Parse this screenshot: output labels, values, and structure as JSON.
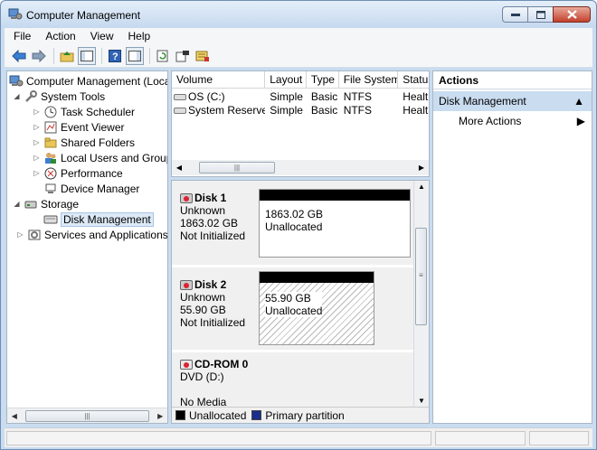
{
  "window": {
    "title": "Computer Management"
  },
  "menu": [
    "File",
    "Action",
    "View",
    "Help"
  ],
  "toolbar_icons": [
    "back-icon",
    "forward-icon",
    "up-folder-icon",
    "show-tree-icon",
    "help-icon",
    "show-action-pane-icon",
    "refresh-icon",
    "properties-icon",
    "disk-settings-icon"
  ],
  "tree": {
    "root": "Computer Management (Local",
    "system_tools": "System Tools",
    "task_scheduler": "Task Scheduler",
    "event_viewer": "Event Viewer",
    "shared_folders": "Shared Folders",
    "local_users": "Local Users and Groups",
    "performance": "Performance",
    "device_manager": "Device Manager",
    "storage": "Storage",
    "disk_management": "Disk Management",
    "services": "Services and Applications"
  },
  "volume_list": {
    "columns": [
      "Volume",
      "Layout",
      "Type",
      "File System",
      "Status"
    ],
    "column_headers_visible": [
      "Volume",
      "Layout",
      "Type",
      "File System",
      "Statu"
    ],
    "rows": [
      [
        "OS (C:)",
        "Simple",
        "Basic",
        "NTFS",
        "Healt"
      ],
      [
        "System Reserved",
        "Simple",
        "Basic",
        "NTFS",
        "Healt"
      ]
    ]
  },
  "disks": [
    {
      "name": "Disk 1",
      "type": "Unknown",
      "size": "1863.02 GB",
      "state": "Not Initialized",
      "partition_size": "1863.02 GB",
      "partition_state": "Unallocated"
    },
    {
      "name": "Disk 2",
      "type": "Unknown",
      "size": "55.90 GB",
      "state": "Not Initialized",
      "partition_size": "55.90 GB",
      "partition_state": "Unallocated"
    },
    {
      "name": "CD-ROM 0",
      "type": "DVD (D:)",
      "state": "No Media"
    }
  ],
  "legend": [
    {
      "label": "Unallocated",
      "color": "#000000"
    },
    {
      "label": "Primary partition",
      "color": "#1a2e8c"
    }
  ],
  "actions": {
    "header": "Actions",
    "section": "Disk Management",
    "more": "More Actions"
  },
  "colors": {
    "titlebar": "#c9dcf0",
    "selection": "#dde9f6",
    "section_bg": "#c9dcf0"
  }
}
